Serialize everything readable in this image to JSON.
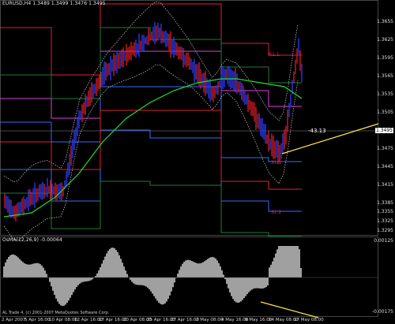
{
  "window": {
    "symbol": "EURUSD,H4",
    "ohlc": "1.3489 1.3499 1.3476 1.3495"
  },
  "oscillator": {
    "title": "OsMA(12,26,9) -0.00064",
    "scale_top": "0.00125",
    "scale_bottom": "-0.00175"
  },
  "price_axis": [
    "1.3655",
    "1.3625",
    "1.3595",
    "1.3565",
    "1.3535",
    "1.3505",
    "1.3475",
    "1.3445",
    "1.3415",
    "1.3385",
    "1.3355",
    "1.3325",
    "1.3295"
  ],
  "current_price": "1.3495",
  "time_axis": [
    "2 Apr 2007",
    "5 Apr 16:00",
    "10 Apr 08:00",
    "12 Apr 16:00",
    "17 Apr 16:00",
    "20 Apr 08:00",
    "25 Apr 16:00",
    "27 Apr 16:00",
    "2 May 08:00",
    "4 May 16:00",
    "9 May 16:00",
    "14 May 08:00",
    "17 May 08:00"
  ],
  "annotations": {
    "divergence_value": "-43.13",
    "r1": "R1.1",
    "s1": "S1.1",
    "s2": "S1.2"
  },
  "footer": "AL Trade 4, (c) 2001-2007 MetaQuotes Software Corp.",
  "colors": {
    "bull_bar": "#2b3dff",
    "bear_bar": "#e01b24",
    "ma_line": "#22dd33",
    "bands": "#d0d0d0",
    "pivot_red": "#e0203a",
    "pivot_magenta": "#e040e0",
    "pivot_blue": "#3a6cff",
    "pivot_green": "#1e7a3a",
    "trendline": "#ffe64a"
  }
}
